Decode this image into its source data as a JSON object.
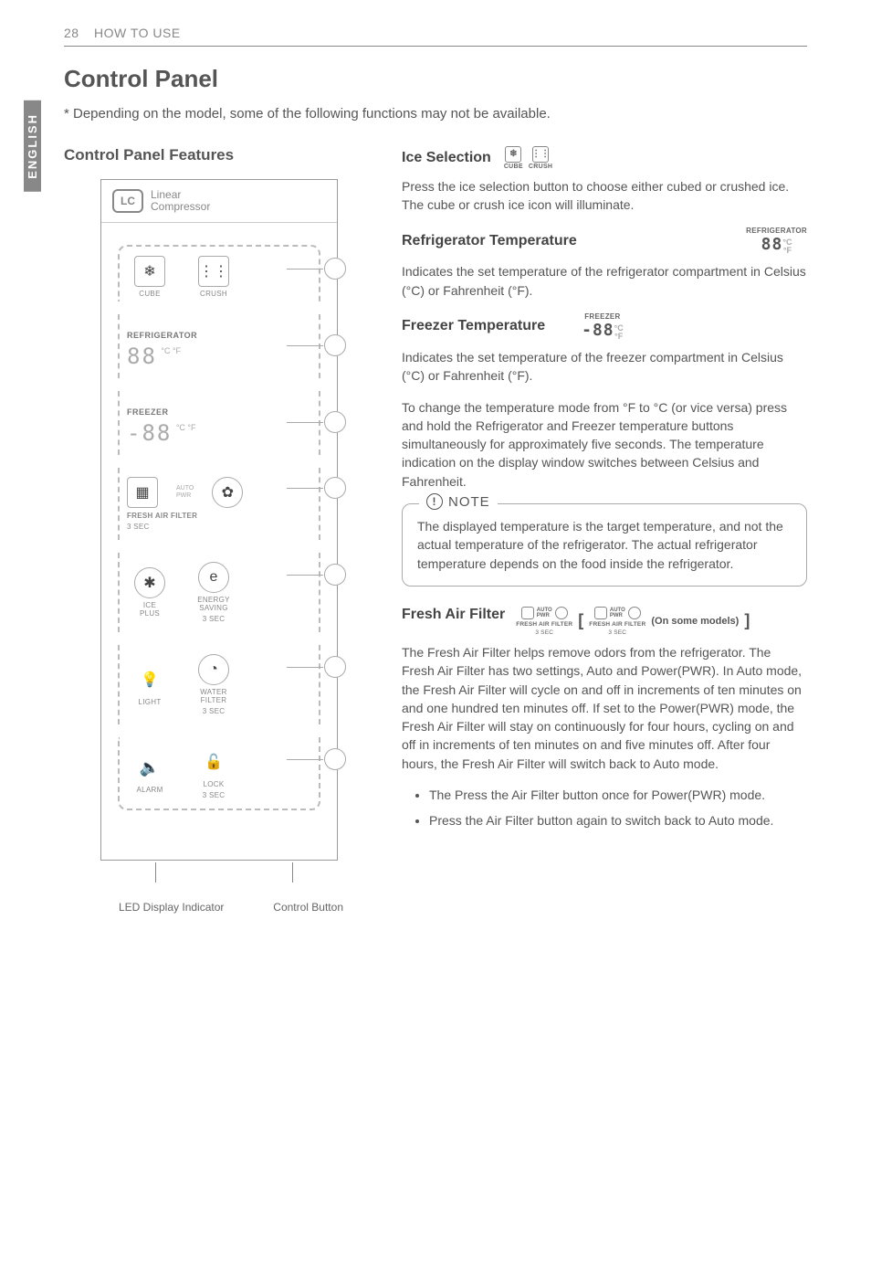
{
  "header": {
    "page": "28",
    "section": "HOW TO USE"
  },
  "sideTab": "ENGLISH",
  "title": "Control Panel",
  "subnote": "* Depending on the model, some of the following functions may not be available.",
  "left": {
    "heading": "Control Panel Features",
    "linear": {
      "badge": "LC",
      "line1": "Linear",
      "line2": "Compressor"
    },
    "panel": {
      "cube": "CUBE",
      "crush": "CRUSH",
      "refrigerator": "REFRIGERATOR",
      "refSeg": "88",
      "refUnits": "°C\n°F",
      "freezer": "FREEZER",
      "frzSeg": "-88",
      "frzUnits": "°C\n°F",
      "freshAir": "FRESH AIR FILTER",
      "freshAirSub": "3 SEC",
      "icePlus": "ICE\nPLUS",
      "energySaving": "ENERGY\nSAVING",
      "energySavingSub": "3 SEC",
      "light": "LIGHT",
      "waterFilter": "WATER\nFILTER",
      "waterFilterSub": "3 SEC",
      "alarm": "ALARM",
      "lock": "LOCK",
      "lockSub": "3 SEC"
    },
    "footer": {
      "left": "LED Display Indicator",
      "right": "Control Button"
    }
  },
  "right": {
    "ice": {
      "heading": "Ice Selection",
      "cube": "CUBE",
      "crush": "CRUSH",
      "body": "Press the ice selection button to choose either cubed or crushed ice. The cube or crush ice icon will illuminate."
    },
    "refTemp": {
      "heading": "Refrigerator Temperature",
      "tiny": "REFRIGERATOR",
      "seg": "88",
      "units": "°C\n°F",
      "body": "Indicates the set temperature of the refrigerator compartment in Celsius (°C) or Fahrenheit (°F)."
    },
    "frzTemp": {
      "heading": "Freezer Temperature",
      "tiny": "FREEZER",
      "seg": "-88",
      "units": "°C\n°F",
      "body1": "Indicates the set temperature of the freezer compartment in Celsius (°C) or Fahrenheit (°F).",
      "body2": "To change the temperature mode from °F to °C (or vice versa) press and hold the Refrigerator and Freezer temperature buttons simultaneously for approximately five seconds. The temperature indication on the display window switches between Celsius and Fahrenheit."
    },
    "note": {
      "title": "NOTE",
      "body": "The displayed temperature is the target temperature, and not the actual temperature of the refrigerator. The actual refrigerator temperature depends on the food inside the refrigerator."
    },
    "faf": {
      "heading": "Fresh Air Filter",
      "label": "FRESH AIR FILTER",
      "sub": "3 SEC",
      "onsome": "(On some models)",
      "body": "The Fresh Air Filter helps remove odors from the refrigerator. The Fresh Air Filter has two settings, Auto and Power(PWR). In Auto mode, the Fresh Air Filter will cycle on and off in increments of ten minutes on and one hundred ten minutes off. If set to the Power(PWR) mode, the Fresh Air Filter will stay on continuously for four hours, cycling on and off in increments of ten minutes on and five minutes off. After four hours, the Fresh Air Filter will switch back to Auto mode.",
      "bullets": [
        "The Press the Air Filter button once for Power(PWR) mode.",
        "Press the Air Filter button again to switch back to Auto mode."
      ]
    }
  }
}
